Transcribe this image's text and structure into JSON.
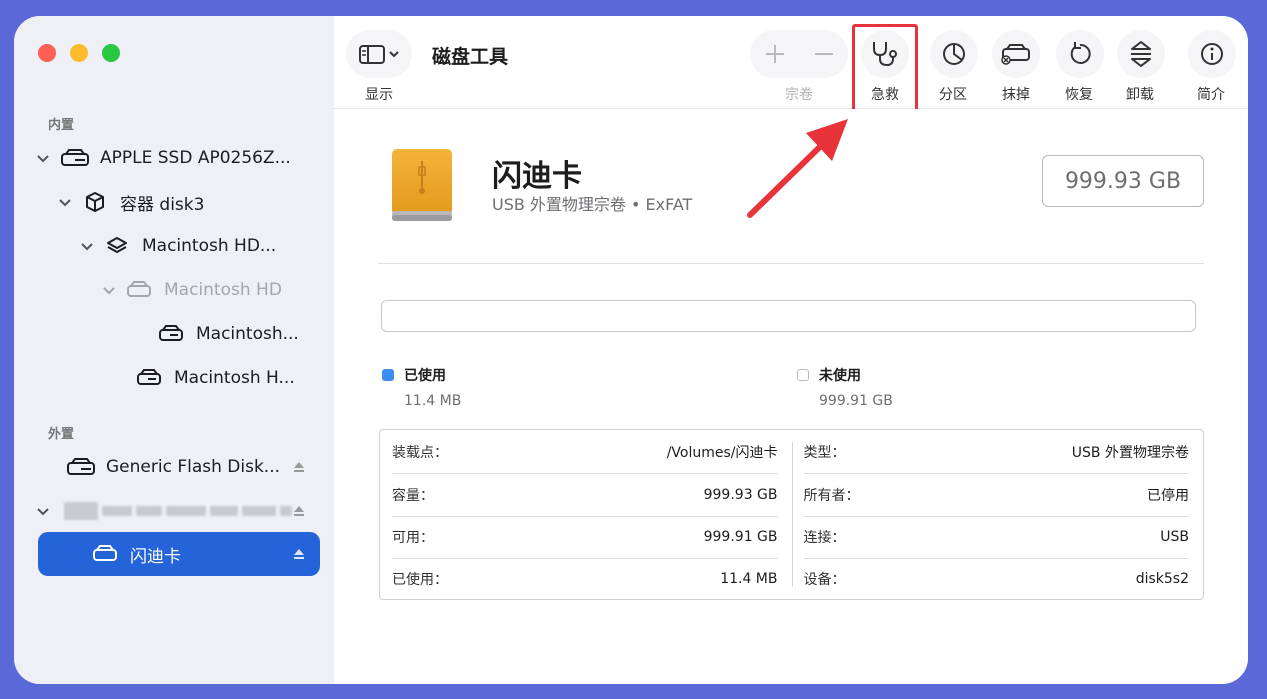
{
  "toolbar": {
    "view_label": "显示",
    "title": "磁盘工具",
    "volume_label": "宗卷",
    "first_aid_label": "急救",
    "partition_label": "分区",
    "erase_label": "抹掉",
    "restore_label": "恢复",
    "unmount_label": "卸载",
    "info_label": "简介"
  },
  "sidebar": {
    "internal_label": "内置",
    "external_label": "外置",
    "items": [
      {
        "label": "APPLE SSD AP0256Z..."
      },
      {
        "label": "容器 disk3"
      },
      {
        "label": "Macintosh HD..."
      },
      {
        "label": "Macintosh HD"
      },
      {
        "label": "Macintosh..."
      },
      {
        "label": "Macintosh H..."
      },
      {
        "label": "Generic Flash Disk..."
      },
      {
        "label": "闪迪卡"
      }
    ]
  },
  "drive": {
    "name": "闪迪卡",
    "subtitle": "USB 外置物理宗卷 • ExFAT",
    "capacity": "999.93 GB"
  },
  "usage": {
    "used_label": "已使用",
    "used_value": "11.4 MB",
    "free_label": "未使用",
    "free_value": "999.91 GB",
    "used_fraction": 1.14e-05,
    "used_color": "#3b8ef0"
  },
  "info": {
    "left": [
      {
        "label": "装载点：",
        "value": "/Volumes/闪迪卡"
      },
      {
        "label": "容量：",
        "value": "999.93 GB"
      },
      {
        "label": "可用：",
        "value": "999.91 GB"
      },
      {
        "label": "已使用：",
        "value": "11.4 MB"
      }
    ],
    "right": [
      {
        "label": "类型：",
        "value": "USB 外置物理宗卷"
      },
      {
        "label": "所有者：",
        "value": "已停用"
      },
      {
        "label": "连接：",
        "value": "USB"
      },
      {
        "label": "设备：",
        "value": "disk5s2"
      }
    ]
  },
  "colors": {
    "accent": "#2563d8",
    "highlight": "#e8333a"
  }
}
